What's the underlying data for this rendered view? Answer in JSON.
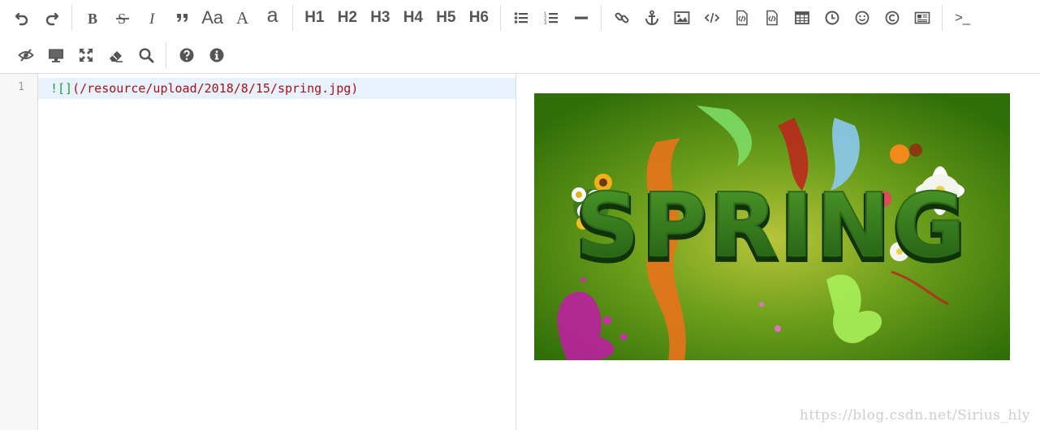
{
  "toolbar": {
    "row1": {
      "heading_labels": [
        "H1",
        "H2",
        "H3",
        "H4",
        "H5",
        "H6"
      ],
      "ucase_label": "Aa",
      "ucfirst_label": "A",
      "lcase_label": "a",
      "terminal_label": ">_"
    }
  },
  "editor": {
    "line_number": "1",
    "line_prefix": "![]",
    "line_url": "(/resource/upload/2018/8/15/spring.jpg)"
  },
  "preview": {
    "image_title": "SPRING",
    "watermark": "https://blog.csdn.net/Sirius_hly"
  }
}
